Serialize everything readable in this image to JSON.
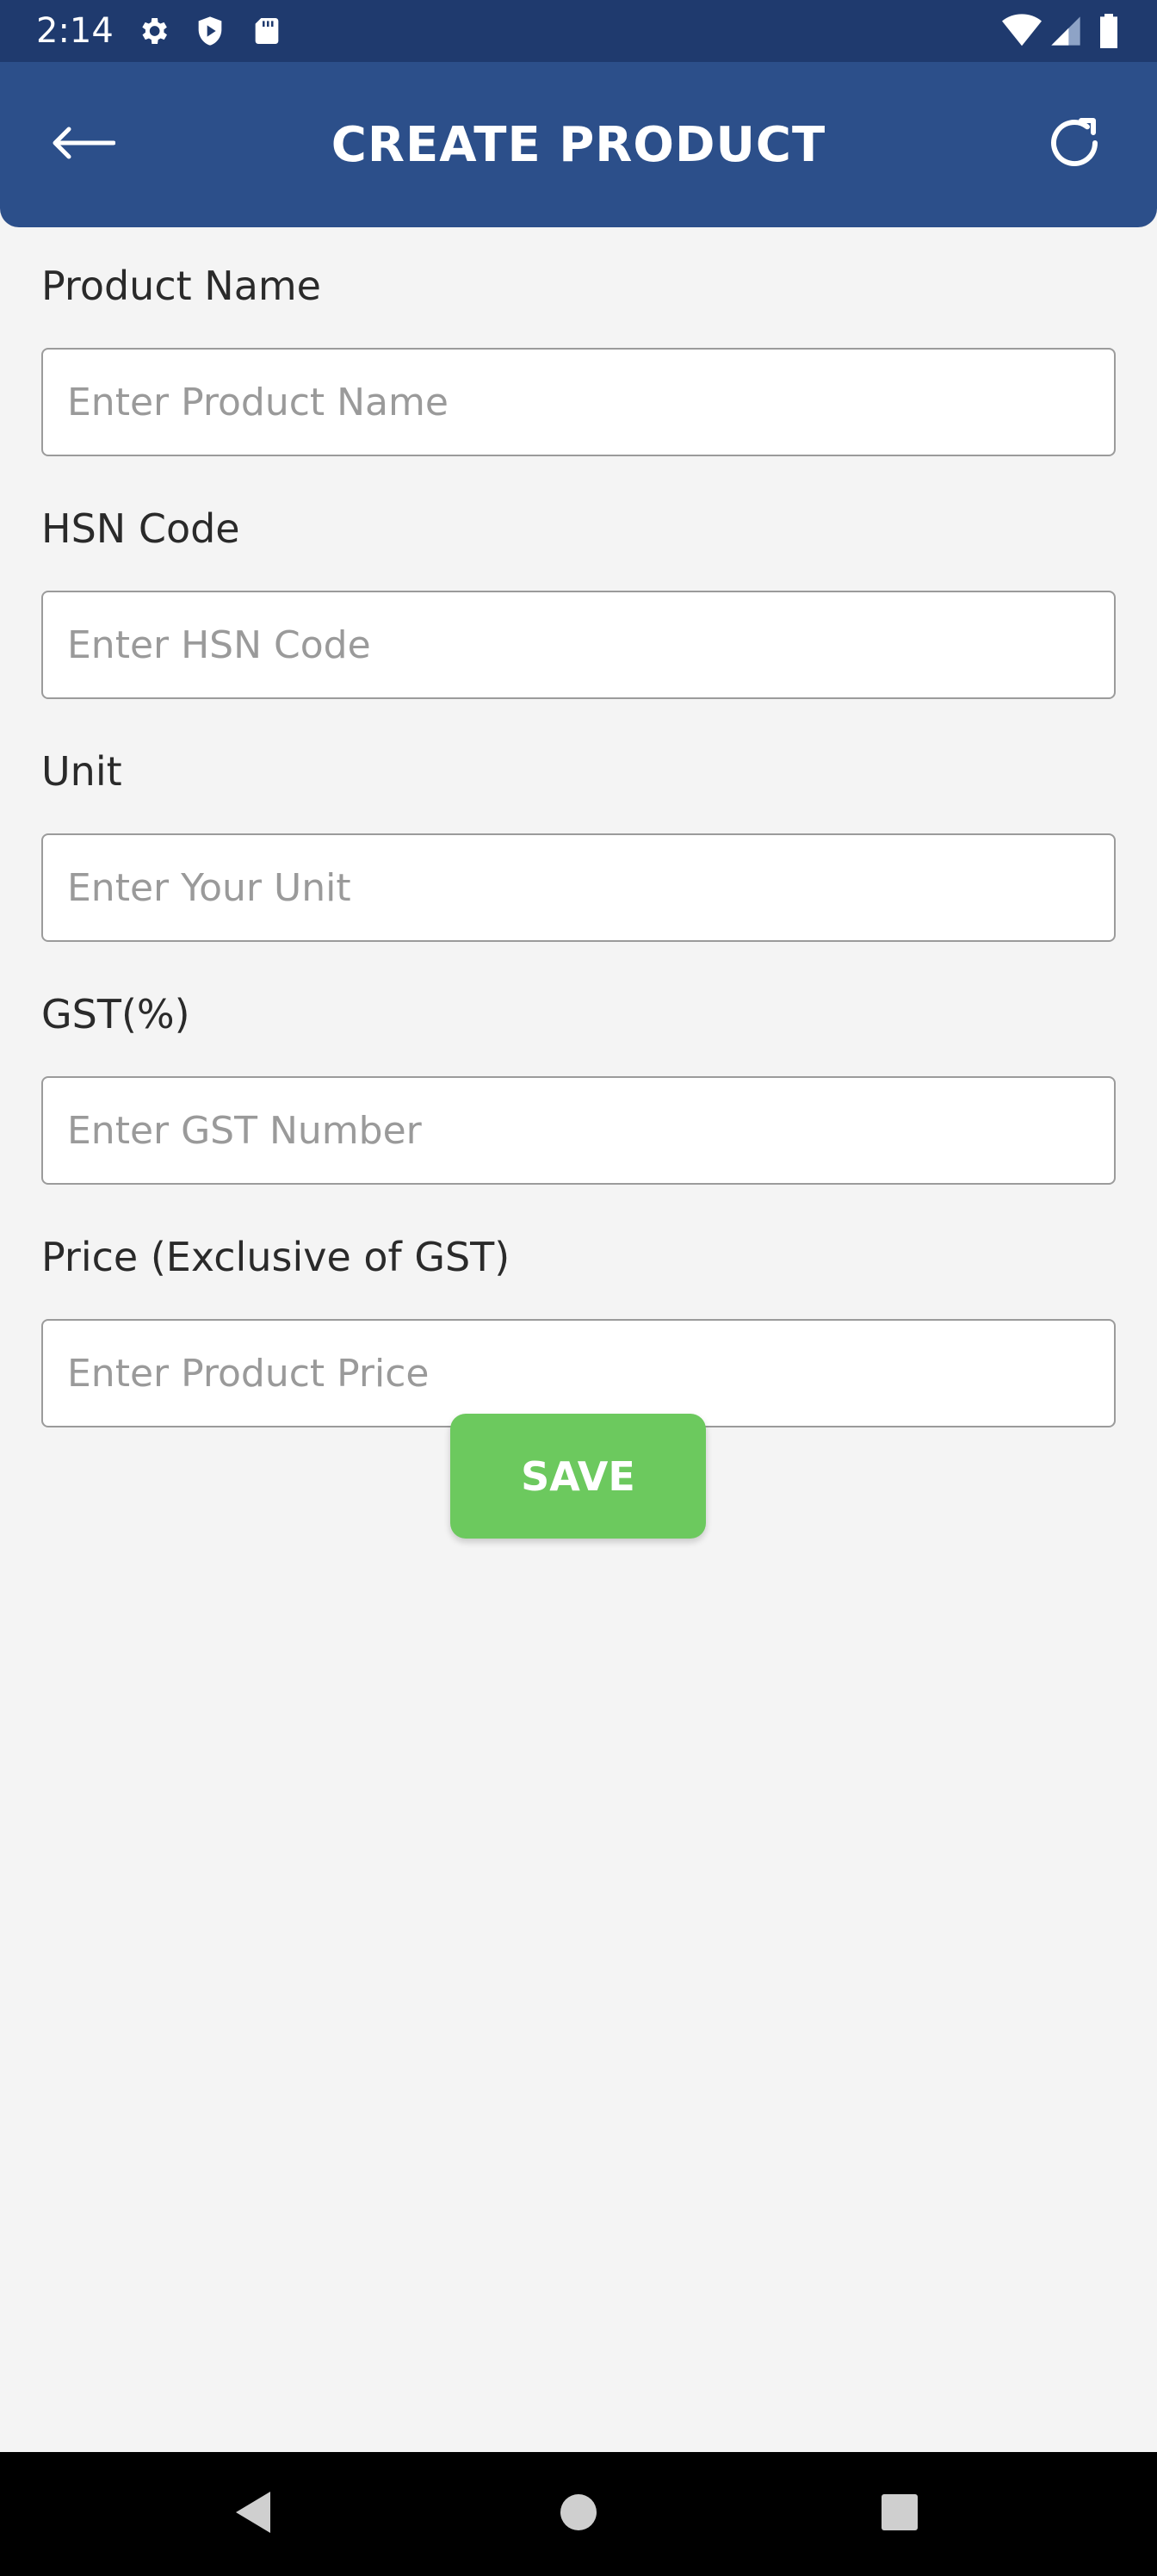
{
  "status_bar": {
    "time": "2:14",
    "icons": [
      "settings-icon",
      "shield-icon",
      "sd-card-icon",
      "wifi-icon",
      "signal-icon",
      "battery-icon"
    ]
  },
  "app_bar": {
    "title": "CREATE PRODUCT",
    "back_icon": "arrow-left-icon",
    "refresh_icon": "refresh-icon"
  },
  "form": {
    "fields": [
      {
        "label": "Product Name",
        "placeholder": "Enter Product Name",
        "value": ""
      },
      {
        "label": "HSN Code",
        "placeholder": "Enter HSN Code",
        "value": ""
      },
      {
        "label": "Unit",
        "placeholder": "Enter Your Unit",
        "value": ""
      },
      {
        "label": "GST(%)",
        "placeholder": "Enter GST Number",
        "value": ""
      },
      {
        "label": "Price (Exclusive of GST)",
        "placeholder": "Enter Product Price",
        "value": ""
      }
    ],
    "save_label": "SAVE"
  },
  "nav_bar": {
    "icons": [
      "back-triangle-icon",
      "home-circle-icon",
      "recents-square-icon"
    ]
  },
  "colors": {
    "status_bar": "#1f3a6e",
    "app_bar": "#2c4f8a",
    "save_button": "#6cc95e",
    "background": "#f4f4f4"
  }
}
